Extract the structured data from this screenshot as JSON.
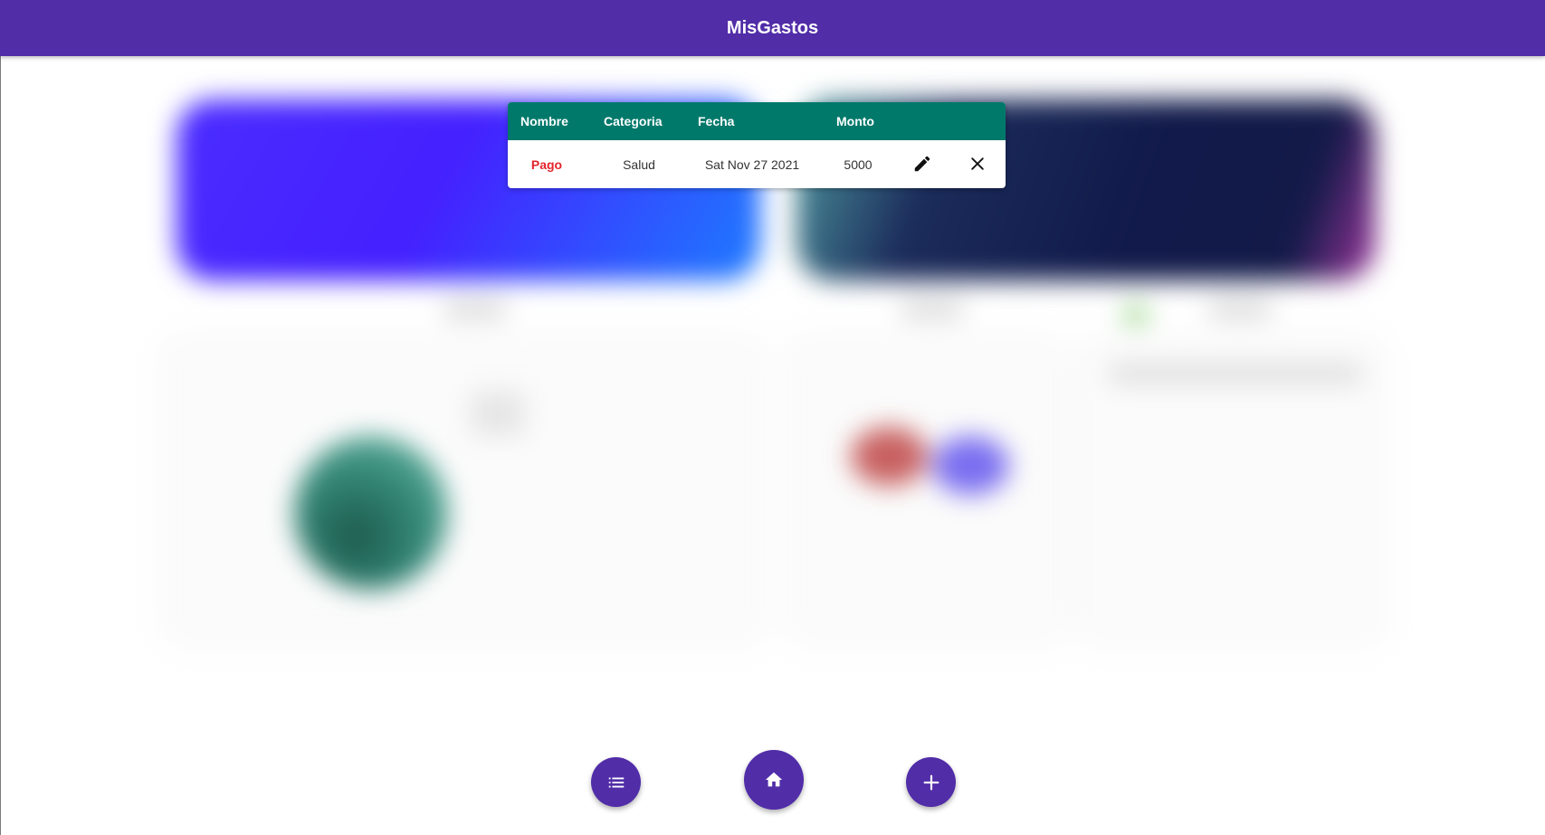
{
  "app": {
    "title": "MisGastos"
  },
  "colors": {
    "appbar": "#512DA8",
    "table_header": "#00796B",
    "expense_name": "#E3242B",
    "fab": "#512DA8"
  },
  "expenses_table": {
    "columns": [
      "Nombre",
      "Categoria",
      "Fecha",
      "Monto"
    ],
    "rows": [
      {
        "nombre": "Pago",
        "categoria": "Salud",
        "fecha": "Sat Nov 27 2021",
        "monto": "5000"
      }
    ],
    "actions": {
      "edit_icon": "pencil-icon",
      "delete_icon": "close-icon"
    }
  },
  "bottom_nav": {
    "list_icon": "list-icon",
    "home_icon": "home-icon",
    "add_icon": "plus-icon"
  }
}
